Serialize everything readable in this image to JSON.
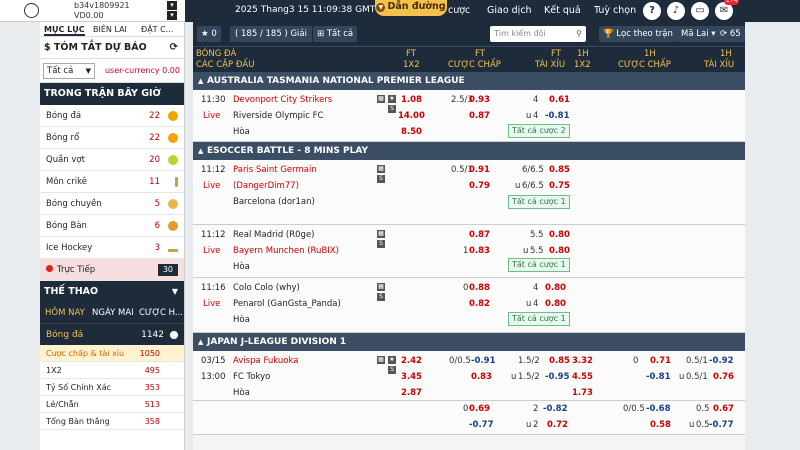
{
  "account": {
    "id": "b34v1809921",
    "balance": "VD0.00"
  },
  "header": {
    "clock": "2025 Thang3 15 11:09:38 GMT +8",
    "guide": "Dẫn đường",
    "nav": [
      "cược",
      "Giao dịch",
      "Kết quả",
      "Tuỳ chọn"
    ],
    "notif_count": "274"
  },
  "sidebar": {
    "tabs": [
      "MỤC LỤC",
      "BIÊN LAI",
      "ĐẶT C..."
    ],
    "summary_title": "$ TÓM TẮT DỰ BÁO",
    "filter": "Tất cả",
    "currency": "user-currency 0.00",
    "inplay_title": "TRONG TRẬN BÂY GIỜ",
    "inplay": [
      {
        "label": "Bóng đá",
        "count": "22"
      },
      {
        "label": "Bóng rổ",
        "count": "22"
      },
      {
        "label": "Quần vợt",
        "count": "20"
      },
      {
        "label": "Môn crikê",
        "count": "11"
      },
      {
        "label": "Bóng chuyền",
        "count": "5"
      },
      {
        "label": "Bóng Bàn",
        "count": "6"
      },
      {
        "label": "Ice Hockey",
        "count": "3"
      }
    ],
    "live_label": "Trực Tiếp",
    "live_count": "30",
    "sports_title": "THẾ THAO",
    "day_tabs": [
      "HÔM NAY",
      "NGÀY MAI",
      "CƯỢC H..."
    ],
    "sport": {
      "label": "Bóng đá",
      "count": "1142"
    },
    "markets": [
      {
        "label": "Cược chấp & tài xỉu",
        "count": "1050"
      },
      {
        "label": "1X2",
        "count": "495"
      },
      {
        "label": "Tỷ Số Chính Xác",
        "count": "353"
      },
      {
        "label": "Lẻ/Chẵn",
        "count": "513"
      },
      {
        "label": "Tổng Bàn thắng",
        "count": "358"
      }
    ]
  },
  "toolbar": {
    "star": "0",
    "count": "( 185 / 185 )",
    "count_suffix": "Giải",
    "all": "Tất cả",
    "search_placeholder": "Tìm kiếm đội",
    "filter_btn": "Lọc theo trận",
    "refresh_btn": "Mã Lai",
    "refresh_count": "65"
  },
  "columns": {
    "sport": "BÓNG ĐÁ",
    "matches": "CÁC CẶP ĐẤU",
    "ft": "FT",
    "h1": "1H",
    "x12": "1X2",
    "handicap": "CƯỢC CHẤP",
    "ou": "TÀI XỈU"
  },
  "leagues": [
    {
      "name": "AUSTRALIA TASMANIA NATIONAL PREMIER LEAGUE"
    },
    {
      "name": "ESOCCER BATTLE - 8 MINS PLAY"
    },
    {
      "name": "JAPAN J-LEAGUE DIVISION 1"
    }
  ],
  "matches": {
    "m1": {
      "time": "11:30",
      "status": "Live",
      "home": "Devonport City Strikers",
      "away": "Riverside Olympic FC",
      "draw": "Hòa",
      "x1": "1.08",
      "x2": "14.00",
      "xd": "8.50",
      "hcap": "2.5/3",
      "h_home": "0.93",
      "h_away": "0.87",
      "ou_line": "4",
      "ou_over": "0.61",
      "ou_u": "u",
      "ou_line2": "4",
      "ou_under": "-0.81",
      "all": "Tất cả cược 2"
    },
    "m2": {
      "time": "11:12",
      "status": "Live",
      "home": "Paris Saint Germain",
      "home2": "(DangerDim77)",
      "away": "Barcelona (dor1an)",
      "hcap": "0.5/1",
      "h_home": "0.91",
      "h_away": "0.79",
      "ou_line": "6/6.5",
      "ou_over": "0.85",
      "ou_u": "u",
      "ou_line2": "6/6.5",
      "ou_under": "0.75",
      "all": "Tất cả cược 1"
    },
    "m3": {
      "time": "11:12",
      "status": "Live",
      "home": "Real Madrid (R0ge)",
      "away": "Bayern Munchen (RuBIX)",
      "draw": "Hòa",
      "h_home": "0.87",
      "hcap2": "1",
      "h_away": "0.83",
      "ou_line": "5.5",
      "ou_over": "0.80",
      "ou_u": "u",
      "ou_line2": "5.5",
      "ou_under": "0.80",
      "all": "Tất cả cược 1"
    },
    "m4": {
      "time": "11:16",
      "status": "Live",
      "home": "Colo Colo (why)",
      "away": "Penarol (GanGsta_Panda)",
      "draw": "Hòa",
      "hcap": "0",
      "h_home": "0.88",
      "h_away": "0.82",
      "ou_line": "4",
      "ou_over": "0.80",
      "ou_u": "u",
      "ou_line2": "4",
      "ou_under": "0.80",
      "all": "Tất cả cược 1"
    },
    "m5": {
      "date": "03/15",
      "time": "13:00",
      "home": "Avispa Fukuoka",
      "away": "FC Tokyo",
      "draw": "Hòa",
      "x1": "2.42",
      "x2": "3.45",
      "xd": "2.87",
      "hcap": "0/0.5",
      "h_home": "-0.91",
      "h_away": "0.83",
      "ou_line": "1.5/2",
      "ou_over": "0.85",
      "ou_u": "u",
      "ou_line2": "1.5/2",
      "ou_under": "-0.95",
      "h1_x1": "3.32",
      "h1_x2": "4.55",
      "h1_xd": "1.73",
      "h1_hcap": "0",
      "h1_home": "0.71",
      "h1_away": "-0.81",
      "h1_ou": "0.5/1",
      "h1_over": "-0.92",
      "h1_ou2": "0.5/1",
      "h1_under": "0.76"
    },
    "m6": {
      "h_home": "0.69",
      "hcap": "0",
      "h_away": "-0.77",
      "ou_line": "2",
      "ou_over": "-0.82",
      "ou_u": "u",
      "ou_line2": "2",
      "ou_under": "0.72",
      "h1_hcap": "0/0.5",
      "h1_home": "-0.68",
      "h1_away": "0.58",
      "h1_ou": "0.5",
      "h1_over": "0.67",
      "h1_ou2": "0.5",
      "h1_under": "-0.77"
    }
  }
}
